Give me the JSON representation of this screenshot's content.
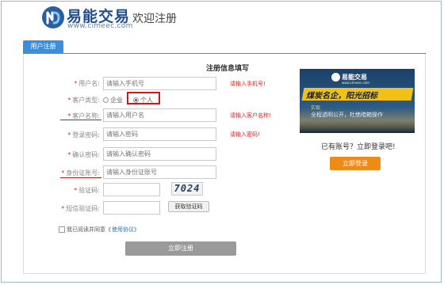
{
  "header": {
    "brand_name": "易能交易",
    "brand_url": "www.cimeec.com",
    "welcome": "欢迎注册"
  },
  "tabs": [
    {
      "label": "用户注册",
      "active": true
    }
  ],
  "form": {
    "title": "注册信息填写",
    "fields": {
      "username": {
        "label": "用户名:",
        "placeholder": "请输入手机号",
        "hint": "请输入手机号!"
      },
      "customer_type": {
        "label": "客户类型:",
        "options": [
          "企业",
          "个人"
        ],
        "selected": "个人"
      },
      "customer_name": {
        "label": "客户名称:",
        "placeholder": "请输入用户名",
        "hint": "请输入客户名称!"
      },
      "password": {
        "label": "登录密码:",
        "placeholder": "请输入密码",
        "hint": "请输入密码!"
      },
      "confirm_password": {
        "label": "确认密码:",
        "placeholder": "请输入确认密码"
      },
      "id_number": {
        "label": "身份证账号:",
        "placeholder": "请输入身份证账号"
      },
      "captcha": {
        "label": "验证码:",
        "image_text": "7024"
      },
      "sms_code": {
        "label": "短信验证码:",
        "button": "获取验证码"
      }
    },
    "agreement": {
      "text": "我已阅读并同意《",
      "link": "使用协议》"
    },
    "submit": "立即注册"
  },
  "sidebar": {
    "ad": {
      "brand": "易能交易",
      "url": "www.cimeec.com",
      "slogan": "煤炭名企，阳光招标",
      "sub_tag": "实现",
      "sub_text": "全程透明公开，杜绝暗箱操作"
    },
    "have_account": "已有账号？立即登录吧!",
    "login_button": "立即登录"
  },
  "colors": {
    "accent": "#3b8ed7",
    "required": "#e22222",
    "login": "#f08a17",
    "submit": "#9a9a9a",
    "brand": "#1f4e8c",
    "annotation": "#d41414"
  }
}
